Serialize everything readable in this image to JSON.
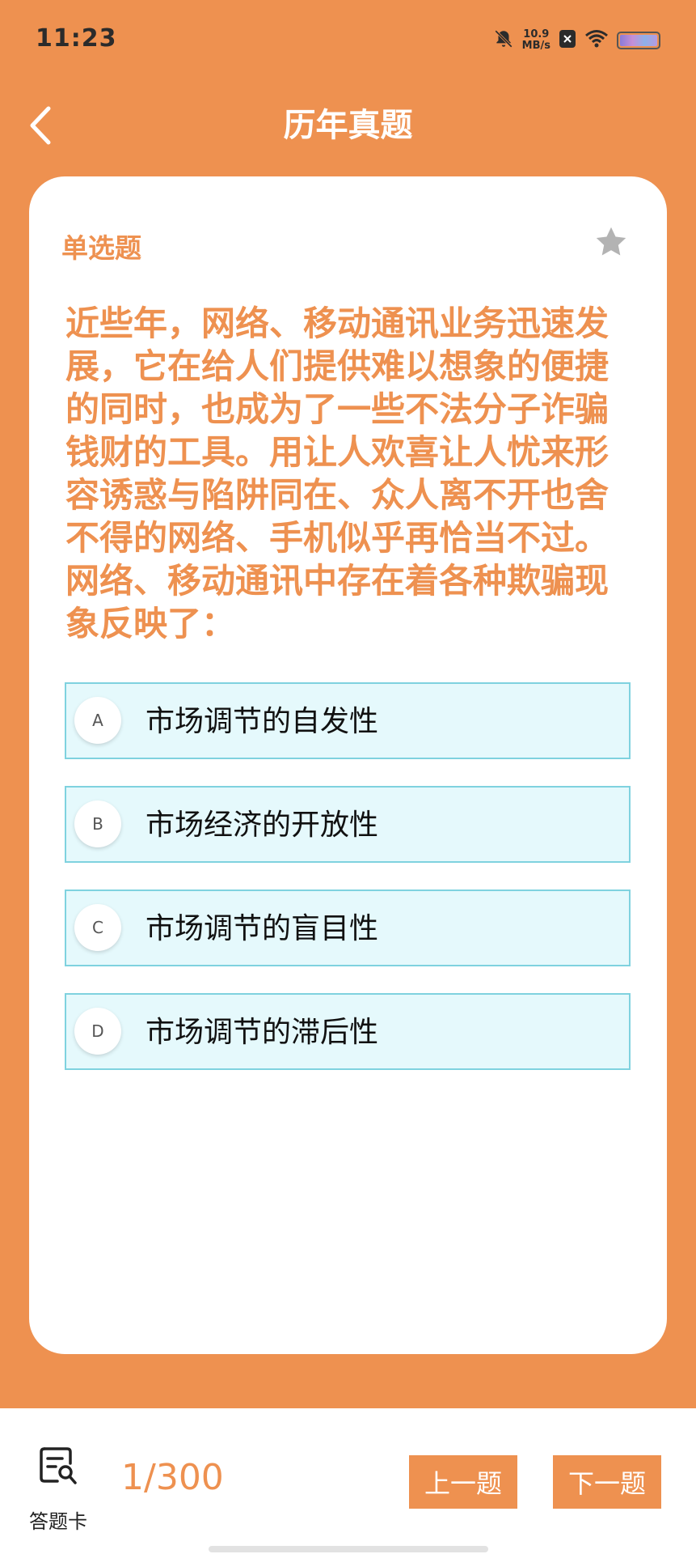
{
  "status_bar": {
    "time": "11:23",
    "net_speed_value": "10.9",
    "net_speed_unit": "MB/s",
    "icons": [
      "bell-muted-icon",
      "sim-off-icon",
      "wifi-icon",
      "battery-icon"
    ]
  },
  "header": {
    "title": "历年真题",
    "back_icon": "chevron-left-icon"
  },
  "question": {
    "type": "单选题",
    "favorite_icon": "star-icon",
    "text": "近些年，网络、移动通讯业务迅速发展，它在给人们提供难以想象的便捷的同时，也成为了一些不法分子诈骗钱财的工具。用让人欢喜让人忧来形容诱惑与陷阱同在、众人离不开也舍不得的网络、手机似乎再恰当不过。网络、移动通讯中存在着各种欺骗现象反映了："
  },
  "options": [
    {
      "letter": "A",
      "text": "市场调节的自发性"
    },
    {
      "letter": "B",
      "text": "市场经济的开放性"
    },
    {
      "letter": "C",
      "text": "市场调节的盲目性"
    },
    {
      "letter": "D",
      "text": "市场调节的滞后性"
    }
  ],
  "bottom": {
    "answer_card_label": "答题卡",
    "answer_card_icon": "answer-sheet-icon",
    "progress": "1/300",
    "prev_label": "上一题",
    "next_label": "下一题"
  },
  "colors": {
    "primary": "#EE9150",
    "option_bg": "#E5F9FC",
    "option_border": "#7FD2DF"
  }
}
